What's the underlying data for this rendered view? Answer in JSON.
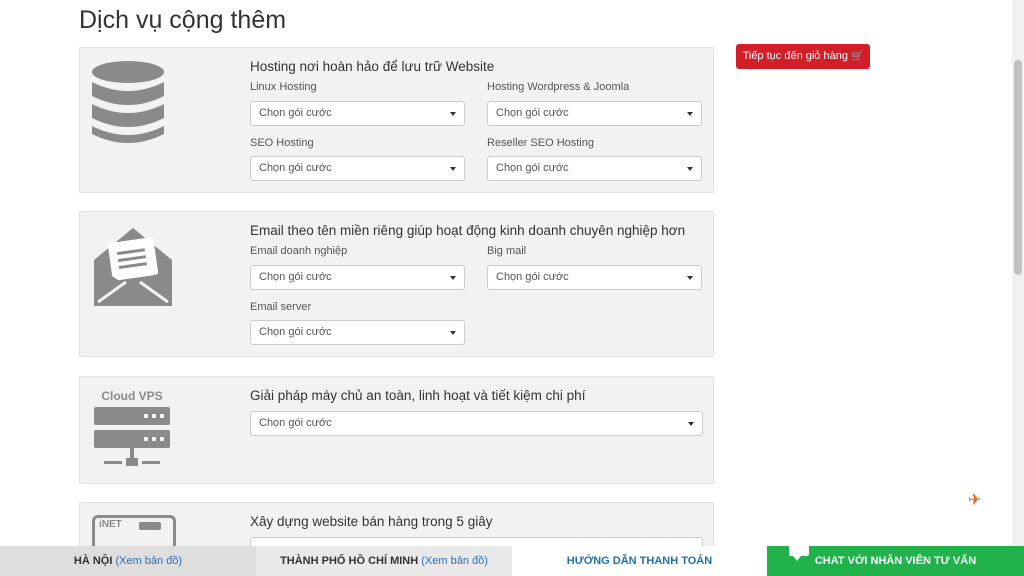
{
  "page": {
    "title": "Dịch vụ cộng thêm"
  },
  "cart_button": {
    "label": "Tiếp tục đến giỏ hàng"
  },
  "select_placeholder": "Chọn gói cước",
  "panels": [
    {
      "icon": "database-icon",
      "heading": "Hosting nơi hoàn hảo để lưu trữ Website",
      "fields": [
        {
          "label": "Linux Hosting",
          "value": "Chọn gói cước"
        },
        {
          "label": "Hosting Wordpress & Joomla",
          "value": "Chọn gói cước"
        },
        {
          "label": "SEO Hosting",
          "value": "Chọn gói cước"
        },
        {
          "label": "Reseller SEO Hosting",
          "value": "Chọn gói cước"
        }
      ]
    },
    {
      "icon": "envelope-icon",
      "heading": "Email theo tên miền riêng giúp hoạt động kinh doanh chuyên nghiệp hơn",
      "fields": [
        {
          "label": "Email doanh nghiệp",
          "value": "Chọn gói cước"
        },
        {
          "label": "Big mail",
          "value": "Chọn gói cước"
        },
        {
          "label": "Email server",
          "value": "Chọn gói cước"
        }
      ]
    },
    {
      "icon": "cloud-vps-icon",
      "icon_text": "Cloud VPS",
      "heading": "Giải pháp máy chủ an toàn, linh hoạt và tiết kiệm chi phí",
      "fields": [
        {
          "label": "",
          "value": "Chọn gói cước"
        }
      ]
    },
    {
      "icon": "inet-website-icon",
      "icon_text": "iNET",
      "heading": "Xây dựng website bán hàng trong 5 giây",
      "fields": []
    }
  ],
  "bottom_bar": {
    "hanoi": {
      "city": "HÀ NỘI",
      "link": "(Xem bản đồ)"
    },
    "hcm": {
      "city": "THÀNH PHỐ HỒ CHÍ MINH",
      "link": "(Xem bản đồ)"
    },
    "guide": "HƯỚNG DẪN THANH TOÁN",
    "chat": "CHAT VỚI NHÂN VIÊN TƯ VẤN"
  },
  "colors": {
    "accent_red": "#d21f27",
    "chat_green": "#22b24c",
    "link_blue": "#2a6ebb",
    "icon_gray": "#8a8a8a",
    "plane_orange": "#e8601c"
  }
}
